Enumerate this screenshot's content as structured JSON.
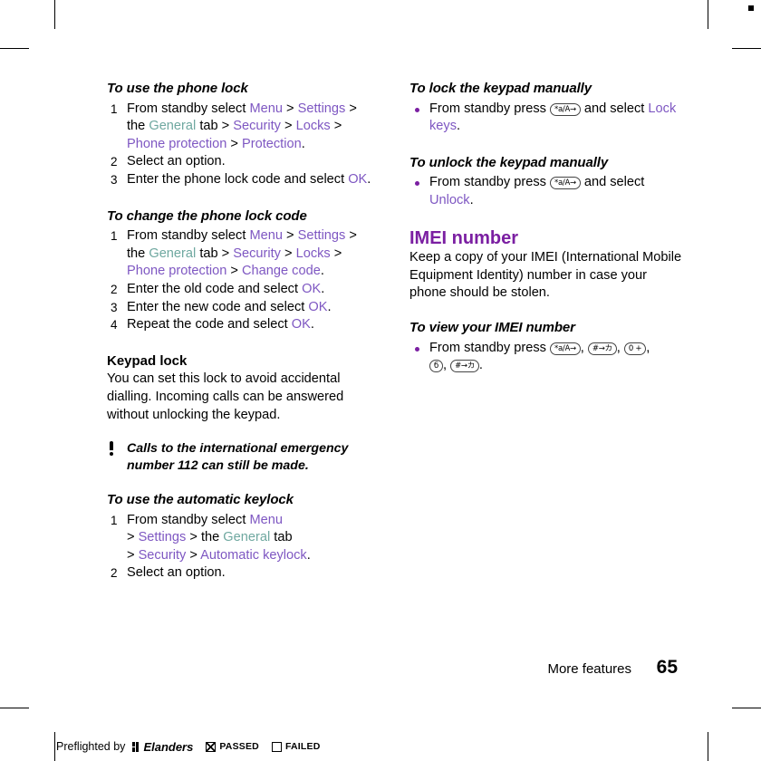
{
  "page": {
    "number": "65",
    "section_label": "More features"
  },
  "left_column": {
    "s1": {
      "title": "To use the phone lock",
      "steps": [
        {
          "parts": [
            {
              "t": "From standby select ",
              "c": "black"
            },
            {
              "t": "Menu",
              "c": "lilac"
            },
            {
              "t": " > ",
              "c": "black"
            },
            {
              "t": "Settings",
              "c": "lilac"
            },
            {
              "t": " > the ",
              "c": "black"
            },
            {
              "t": "General",
              "c": "mint"
            },
            {
              "t": " tab > ",
              "c": "black"
            },
            {
              "t": "Security",
              "c": "lilac"
            },
            {
              "t": " > ",
              "c": "black"
            },
            {
              "t": "Locks",
              "c": "lilac"
            },
            {
              "t": " > ",
              "c": "black"
            },
            {
              "t": "Phone protection",
              "c": "lilac"
            },
            {
              "t": " > ",
              "c": "black"
            },
            {
              "t": "Protection",
              "c": "lilac"
            },
            {
              "t": ".",
              "c": "black"
            }
          ]
        },
        {
          "parts": [
            {
              "t": "Select an option.",
              "c": "black"
            }
          ]
        },
        {
          "parts": [
            {
              "t": "Enter the phone lock code and select ",
              "c": "black"
            },
            {
              "t": "OK",
              "c": "lilac"
            },
            {
              "t": ".",
              "c": "black"
            }
          ]
        }
      ]
    },
    "s2": {
      "title": "To change the phone lock code",
      "steps": [
        {
          "parts": [
            {
              "t": "From standby select ",
              "c": "black"
            },
            {
              "t": "Menu",
              "c": "lilac"
            },
            {
              "t": " > ",
              "c": "black"
            },
            {
              "t": "Settings",
              "c": "lilac"
            },
            {
              "t": " > the ",
              "c": "black"
            },
            {
              "t": "General",
              "c": "mint"
            },
            {
              "t": " tab > ",
              "c": "black"
            },
            {
              "t": "Security",
              "c": "lilac"
            },
            {
              "t": " > ",
              "c": "black"
            },
            {
              "t": "Locks",
              "c": "lilac"
            },
            {
              "t": " > ",
              "c": "black"
            },
            {
              "t": "Phone protection",
              "c": "lilac"
            },
            {
              "t": " > ",
              "c": "black"
            },
            {
              "t": "Change code",
              "c": "lilac"
            },
            {
              "t": ".",
              "c": "black"
            }
          ]
        },
        {
          "parts": [
            {
              "t": "Enter the old code and select ",
              "c": "black"
            },
            {
              "t": "OK",
              "c": "lilac"
            },
            {
              "t": ".",
              "c": "black"
            }
          ]
        },
        {
          "parts": [
            {
              "t": "Enter the new code and select ",
              "c": "black"
            },
            {
              "t": "OK",
              "c": "lilac"
            },
            {
              "t": ".",
              "c": "black"
            }
          ]
        },
        {
          "parts": [
            {
              "t": "Repeat the code and select ",
              "c": "black"
            },
            {
              "t": "OK",
              "c": "lilac"
            },
            {
              "t": ".",
              "c": "black"
            }
          ]
        }
      ]
    },
    "keypad_lock": {
      "title": "Keypad lock",
      "body": "You can set this lock to avoid accidental dialling. Incoming calls can be answered without unlocking the keypad."
    },
    "note": "Calls to the international emergency number 112 can still be made.",
    "s3": {
      "title": "To use the automatic keylock",
      "steps": [
        {
          "parts": [
            {
              "t": "From standby select ",
              "c": "black"
            },
            {
              "t": "Menu",
              "c": "lilac"
            },
            {
              "t": "\n> ",
              "c": "black"
            },
            {
              "t": "Settings",
              "c": "lilac"
            },
            {
              "t": " > the ",
              "c": "black"
            },
            {
              "t": "General",
              "c": "mint"
            },
            {
              "t": " tab",
              "c": "black"
            },
            {
              "t": "\n> ",
              "c": "black"
            },
            {
              "t": "Security",
              "c": "lilac"
            },
            {
              "t": " > ",
              "c": "black"
            },
            {
              "t": "Automatic keylock",
              "c": "lilac"
            },
            {
              "t": ".",
              "c": "black"
            }
          ]
        },
        {
          "parts": [
            {
              "t": "Select an option.",
              "c": "black"
            }
          ]
        }
      ]
    }
  },
  "right_column": {
    "s1": {
      "title": "To lock the keypad manually",
      "bullet_pre": "From standby press ",
      "key": "*a/A→",
      "bullet_mid": " and select ",
      "link": "Lock keys",
      "bullet_end": "."
    },
    "s2": {
      "title": "To unlock the keypad manually",
      "bullet_pre": "From standby press ",
      "key": "*a/A→",
      "bullet_mid": " and select ",
      "link": "Unlock",
      "bullet_end": "."
    },
    "imei": {
      "heading": "IMEI number",
      "body": "Keep a copy of your IMEI (International Mobile Equipment Identity) number in case your phone should be stolen.",
      "sub": "To view your IMEI number",
      "bullet_pre": "From standby press ",
      "keys": [
        "*a/A→",
        "#→カ",
        "0 +",
        "б",
        "#→カ"
      ],
      "bullet_end": "."
    }
  },
  "preflight": {
    "text": "Preflighted by",
    "logo": "Elanders",
    "passed": "PASSED",
    "failed": "FAILED"
  }
}
